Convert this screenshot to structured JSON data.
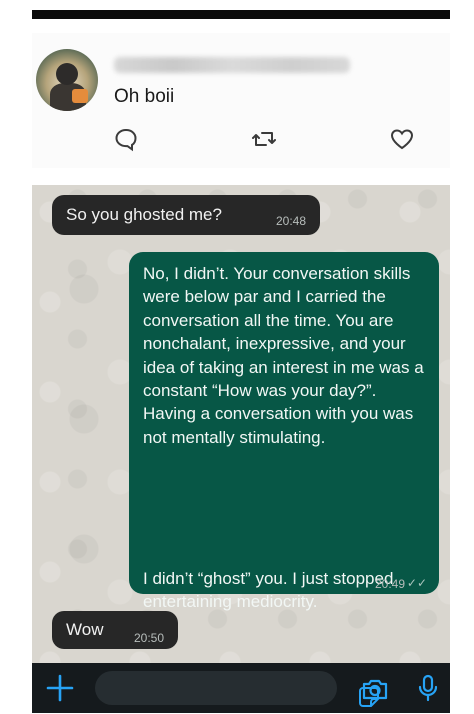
{
  "tweet": {
    "name_blurred": "",
    "text": "Oh boii",
    "icons": [
      "reply-icon",
      "retweet-icon",
      "like-icon"
    ]
  },
  "chat": {
    "messages": [
      {
        "direction": "incoming",
        "text": "So you ghosted me?",
        "time": "20:48"
      },
      {
        "direction": "outgoing",
        "paragraph1": "No, I didn’t. Your conversation skills were below par and I carried the conversation all the time. You are nonchalant, inexpressive, and your idea of taking an interest in me was a constant “How was your day?”. Having a conversation with you was not mentally stimulating.",
        "paragraph2": "I didn’t “ghost” you. I just stopped entertaining mediocrity.",
        "time": "20:49",
        "ticks": "✓✓"
      },
      {
        "direction": "incoming",
        "text": "Wow",
        "time": "20:50"
      }
    ]
  },
  "composer": {
    "icons": [
      "plus-icon",
      "sticker-icon",
      "camera-icon",
      "mic-icon"
    ]
  },
  "colors": {
    "incoming_bubble": "#272727",
    "outgoing_bubble": "#075746",
    "accent": "#27a3f5",
    "chat_background": "#d9d6cf"
  }
}
